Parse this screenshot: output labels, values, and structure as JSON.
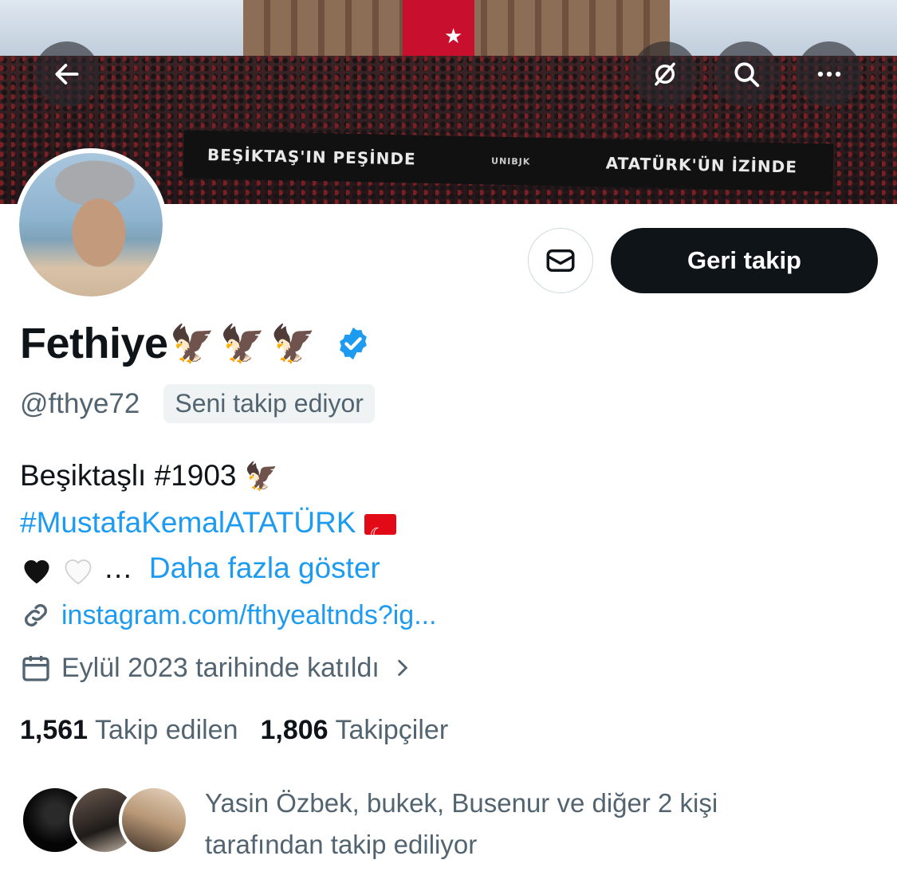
{
  "banner": {
    "text_left": "BEŞİKTAŞ'IN PEŞİNDE",
    "text_mid": "UNIBJK",
    "text_right": "ATATÜRK'ÜN İZİNDE"
  },
  "nav": {
    "back_icon": "arrow-left-icon",
    "grok_icon": "grok-icon",
    "search_icon": "search-icon",
    "more_icon": "more-horizontal-icon"
  },
  "profile": {
    "display_name": "Fethiye",
    "name_emoji": "🦅🦅🦅",
    "handle": "@fthye72",
    "follows_you": "Seni takip ediyor",
    "bio_line1": "Beşiktaşlı #1903",
    "bio_eagle": "🦅",
    "bio_hashtag": "#MustafaKemalATATÜRK",
    "bio_line3_prefix": "…",
    "show_more": "Daha fazla göster",
    "link": "instagram.com/fthyealtnds?ig...",
    "joined": "Eylül 2023 tarihinde katıldı"
  },
  "actions": {
    "follow_back_label": "Geri takip"
  },
  "stats": {
    "following_count": "1,561",
    "following_label": "Takip edilen",
    "followers_count": "1,806",
    "followers_label": "Takipçiler"
  },
  "followed_by": {
    "line1": "Yasin Özbek, bukek, Busenur ve diğer 2 kişi",
    "line2": "tarafından takip ediliyor"
  },
  "colors": {
    "accent": "#1d9bf0",
    "text_primary": "#0f1419",
    "text_secondary": "#536471",
    "button_dark": "#0f1419"
  }
}
